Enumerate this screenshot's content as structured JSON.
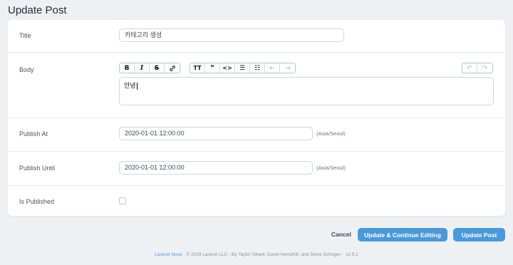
{
  "page": {
    "title": "Update Post"
  },
  "form": {
    "title_label": "Title",
    "title_value": "카테고리 생성",
    "body_label": "Body",
    "body_value": "안녕",
    "publish_at_label": "Publish At",
    "publish_at_value": "2020-01-01 12:00:00",
    "publish_at_tz": "(Asia/Seoul)",
    "publish_until_label": "Publish Until",
    "publish_until_value": "2020-01-01 12:00:00",
    "publish_until_tz": "(Asia/Seoul)",
    "is_published_label": "Is Published",
    "is_published_checked": false
  },
  "toolbar": {
    "bold": "B",
    "italic": "I",
    "strike": "S",
    "link": "🔗",
    "heading": "TT",
    "quote": "❞",
    "code": "<>",
    "bullets": "☰",
    "numbers": "☷",
    "outdent": "⇤",
    "indent": "⇥",
    "undo": "↶",
    "redo": "↷"
  },
  "actions": {
    "cancel": "Cancel",
    "update_continue": "Update & Continue Editing",
    "update": "Update Post"
  },
  "footer": {
    "brand": "Laravel Nova",
    "sep1": "·",
    "credits": "© 2019 Laravel LLC - By Taylor Otwell, David Hemphill, and Steve Schoger.",
    "sep2": "·",
    "version": "v2.9.2"
  },
  "colors": {
    "accent": "#4a99de",
    "background": "#eef1f4"
  }
}
